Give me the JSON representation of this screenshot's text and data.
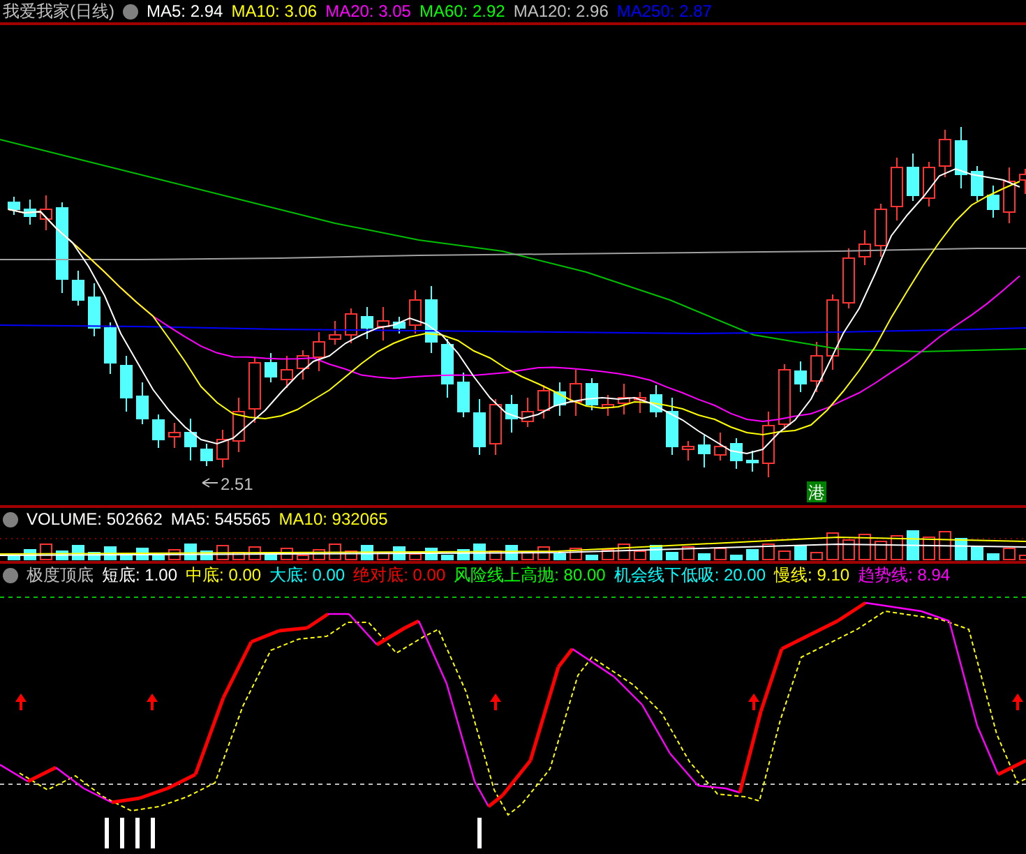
{
  "main": {
    "title": "我爱我家(日线)",
    "legend": [
      {
        "label": "MA5: 2.94",
        "color": "#ffffff"
      },
      {
        "label": "MA10: 3.06",
        "color": "#ffff00"
      },
      {
        "label": "MA20: 3.05",
        "color": "#ff00ff"
      },
      {
        "label": "MA60: 2.92",
        "color": "#00ff00"
      },
      {
        "label": "MA120: 2.96",
        "color": "#c0c0c0"
      },
      {
        "label": "MA250: 2.87",
        "color": "#0000ff"
      }
    ],
    "low_label": "2.51",
    "badge": "港"
  },
  "volume": {
    "legend": [
      {
        "label": "VOLUME: 502662",
        "color": "#ffffff"
      },
      {
        "label": "MA5: 545565",
        "color": "#ffffff"
      },
      {
        "label": "MA10: 932065",
        "color": "#ffff00"
      }
    ]
  },
  "indicator": {
    "title": "极度顶底",
    "legend": [
      {
        "label": "短底: 1.00",
        "color": "#ffffff"
      },
      {
        "label": "中底: 0.00",
        "color": "#ffff00"
      },
      {
        "label": "大底: 0.00",
        "color": "#00ffff"
      },
      {
        "label": "绝对底: 0.00",
        "color": "#ff0000"
      },
      {
        "label": "风险线上高抛: 80.00",
        "color": "#00ff00"
      },
      {
        "label": "机会线下低吸: 20.00",
        "color": "#00ffff"
      },
      {
        "label": "慢线: 9.10",
        "color": "#ffff00"
      },
      {
        "label": "趋势线: 8.94",
        "color": "#ff00ff"
      }
    ]
  }
}
